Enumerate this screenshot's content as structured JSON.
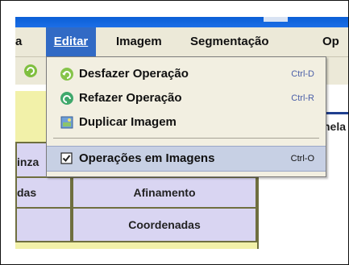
{
  "menubar": {
    "partial_left": "a",
    "editar": "Editar",
    "imagem": "Imagem",
    "segmentacao": "Segmentação",
    "partial_right": "Op"
  },
  "dropdown": {
    "items": [
      {
        "label": "Desfazer Operação",
        "shortcut": "Ctrl-D",
        "icon": "undo-icon"
      },
      {
        "label": "Refazer Operação",
        "shortcut": "Ctrl-R",
        "icon": "redo-icon"
      },
      {
        "label": "Duplicar Imagem",
        "shortcut": "",
        "icon": "duplicate-image-icon"
      },
      {
        "label": "Operações em Imagens",
        "shortcut": "Ctrl-O",
        "icon": "checkbox-checked-icon",
        "checked": true
      }
    ]
  },
  "panel": {
    "cell_inza": "inza",
    "cell_das": "das",
    "cell_afinamento": "Afinamento",
    "cell_coordenadas": "Coordenadas"
  },
  "right_label": "nela",
  "colors": {
    "menu_highlight": "#316ac5",
    "menu_background": "#ece9d8",
    "panel_yellow": "#f2f1a9",
    "cell_lavender": "#d9d5f2",
    "selected_item": "#c7d0e4"
  }
}
